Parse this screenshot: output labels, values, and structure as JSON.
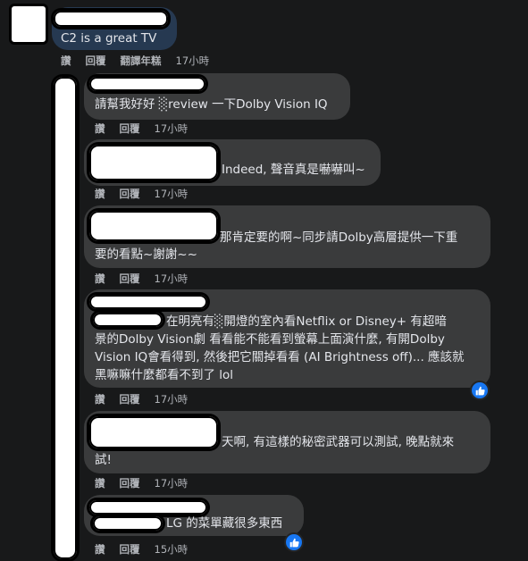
{
  "actions": {
    "like": "讚",
    "reply": "回覆",
    "translate": "翻譯年糕"
  },
  "comments": [
    {
      "text": "C2 is a great TV",
      "time": "17小時"
    },
    {
      "text": "請幫我好好 ░review 一下Dolby Vision IQ",
      "time": "17小時"
    },
    {
      "text": "Indeed, 聲音真是嚇嚇叫~",
      "time": "17小時"
    },
    {
      "line1": "那肯定要的啊~同步請Dolby高層提供一下重",
      "line2": "要的看點~謝謝~~",
      "time": "17小時"
    },
    {
      "line1": "在明亮有░開燈的室內看Netflix or Disney+ 有超暗",
      "line2": "景的Dolby Vision劇 看看能不能看到螢幕上面演什麼, 有開Dolby",
      "line3": "Vision IQ會看得到, 然後把它關掉看看 (AI Brightness off)... 應該就",
      "line4": "黑嘛嘛什麼都看不到了 lol",
      "time": "17小時",
      "reaction": "like-icon"
    },
    {
      "line1": "天啊, 有這樣的秘密武器可以測試, 晚點就來",
      "line2": "試!",
      "time": "17小時"
    },
    {
      "text": "LG 的菜單藏很多東西",
      "time": "15小時",
      "reaction": "like-icon"
    }
  ],
  "colors": {
    "background": "#18191a",
    "bubble": "#3a3b3c",
    "selected_bubble": "#263951",
    "like": "#1877f2"
  }
}
